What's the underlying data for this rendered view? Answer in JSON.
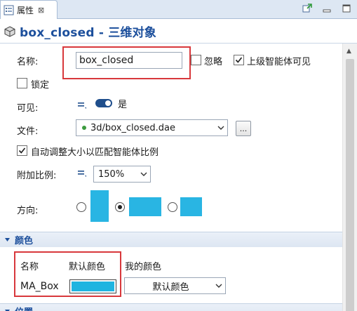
{
  "tab": {
    "label": "属性",
    "close": "⊠"
  },
  "title": "box_closed - 三维对象",
  "fields": {
    "name_label": "名称:",
    "name_value": "box_closed",
    "ignore_label": "忽略",
    "upper_visible_label": "上级智能体可见",
    "lock_label": "锁定",
    "visible_label": "可见:",
    "visible_value": "是",
    "file_label": "文件:",
    "file_value": "3d/box_closed.dae",
    "browse_label": "...",
    "autoscale_label": "自动调整大小以匹配智能体比例",
    "scale_label": "附加比例:",
    "scale_value": "150%",
    "direction_label": "方向:"
  },
  "checkboxes": {
    "ignore": false,
    "upper_visible": true,
    "lock": false,
    "autoscale": true
  },
  "direction": {
    "selected": 1
  },
  "colors_section": {
    "title": "颜色",
    "col_name": "名称",
    "col_default": "默认颜色",
    "col_mine": "我的颜色",
    "row_name": "MA_Box",
    "row_mine_value": "默认颜色",
    "swatch_color": "#1fb4e0"
  },
  "position_section": {
    "title": "位置"
  },
  "theme": {
    "accent": "#1c4f9c",
    "highlight": "#d8383c",
    "cyan": "#29b5e3"
  }
}
